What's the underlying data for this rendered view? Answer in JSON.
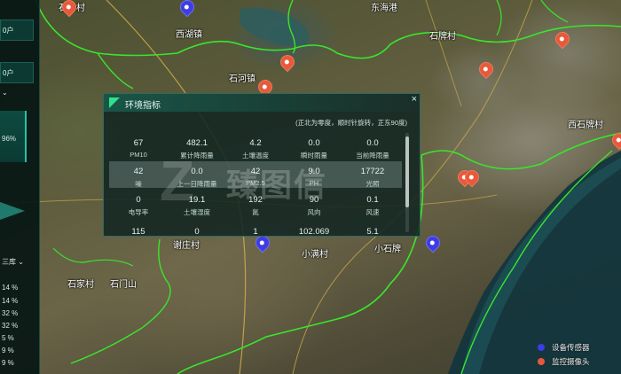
{
  "map": {
    "labels": [
      "西湖镇",
      "石河镇",
      "东海港",
      "石牌村",
      "西石牌村",
      "谢庄村",
      "石家村",
      "小满村",
      "小石牌",
      "石门山",
      "石沟村"
    ]
  },
  "left_panel": {
    "cells": [
      "0户",
      "0户"
    ],
    "percent_top": "96%",
    "dropdown_label": "三库 ⌄",
    "rows": [
      "14 %",
      "14 %",
      "32 %",
      "32 %",
      "5 %",
      "9 %",
      "9 %",
      "9 %"
    ]
  },
  "popup": {
    "title": "环境指标",
    "note": "(正北为零度，顺时针旋转，正东90度)",
    "close": "×",
    "cells": [
      {
        "value": "67",
        "label": "PM10"
      },
      {
        "value": "482.1",
        "label": "累计降雨量"
      },
      {
        "value": "4.2",
        "label": "土壤温度"
      },
      {
        "value": "0.0",
        "label": "瞬时雨量"
      },
      {
        "value": "0.0",
        "label": "当前降雨量"
      },
      {
        "value": "42",
        "label": "噪"
      },
      {
        "value": "0.0",
        "label": "上一日降雨量"
      },
      {
        "value": "42",
        "label": "PM2.5"
      },
      {
        "value": "9.0",
        "label": "PH"
      },
      {
        "value": "17722",
        "label": "光照"
      },
      {
        "value": "0",
        "label": "电导率"
      },
      {
        "value": "19.1",
        "label": "土壤湿度"
      },
      {
        "value": "192",
        "label": "氮"
      },
      {
        "value": "90",
        "label": "风向"
      },
      {
        "value": "0.1",
        "label": "风速"
      },
      {
        "value": "115",
        "label": ""
      },
      {
        "value": "0",
        "label": ""
      },
      {
        "value": "1",
        "label": ""
      },
      {
        "value": "102.069",
        "label": ""
      },
      {
        "value": "5.1",
        "label": ""
      }
    ]
  },
  "watermark": "臻图信",
  "legend": {
    "items": [
      {
        "label": "设备传感器",
        "color": "#3d3de6"
      },
      {
        "label": "监控摄像头",
        "color": "#e8593a"
      }
    ]
  },
  "colors": {
    "accent": "#2fe08f",
    "boundary": "#39e62c",
    "road": "#d9b44a"
  }
}
